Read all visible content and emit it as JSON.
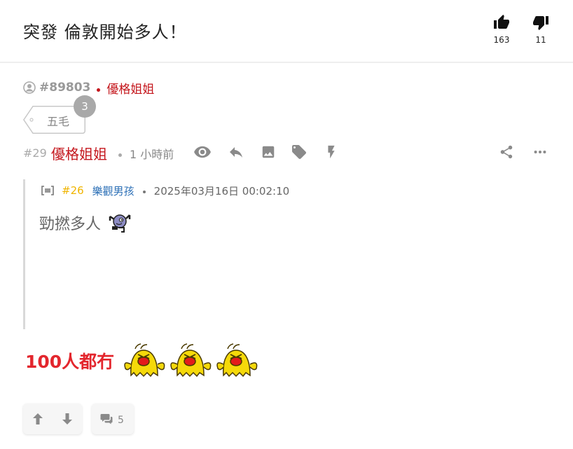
{
  "header": {
    "title": "突發 倫敦開始多人！",
    "upvotes": "163",
    "downvotes": "11"
  },
  "thread": {
    "id": "#89803",
    "op_name": "優格姐姐"
  },
  "tag": {
    "label": "五毛",
    "count": "3"
  },
  "post": {
    "floor": "#29",
    "author": "優格姐姐",
    "time": "1 小時前",
    "quote": {
      "floor": "#26",
      "user": "樂觀男孩",
      "date": "2025年03月16日 00:02:10",
      "text": "勁撚多人"
    },
    "reply_text": "100人都冇",
    "comment_count": "5"
  },
  "icons": {
    "upvote": "thumbs-up-icon",
    "downvote": "thumbs-down-icon",
    "user": "user-icon",
    "view": "eye-icon",
    "reply": "reply-icon",
    "image": "image-icon",
    "tag": "tag-icon",
    "quick": "lightning-icon",
    "share": "share-icon",
    "more": "more-icon",
    "quote": "quote-icon",
    "arrow_up": "arrow-up-icon",
    "arrow_down": "arrow-down-icon",
    "comment": "comment-icon"
  },
  "colors": {
    "accent_red": "#c4161c",
    "reply_red": "#e3262d",
    "quote_floor": "#f0b400",
    "quote_user": "#2b6fb6",
    "icon_grey": "#8a8a8a",
    "sticker_yellow": "#f5d90a"
  }
}
